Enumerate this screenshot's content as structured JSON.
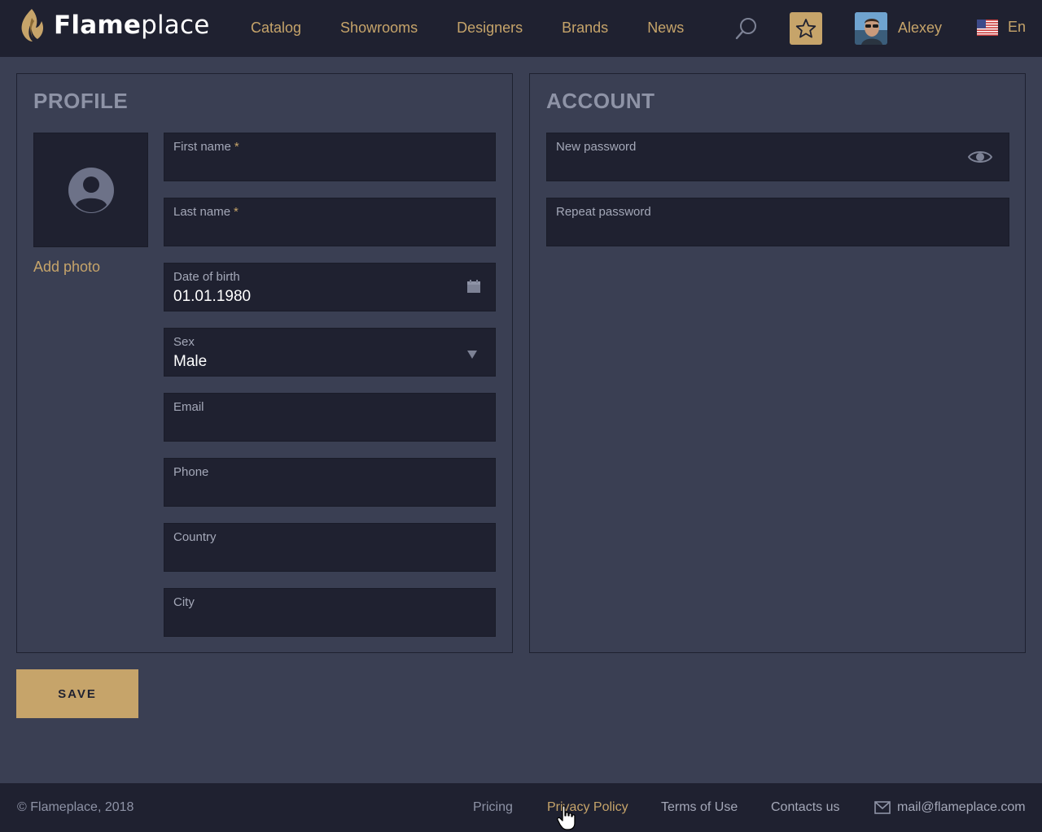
{
  "header": {
    "logo_bold": "Flame",
    "logo_light": "place",
    "nav": [
      "Catalog",
      "Showrooms",
      "Designers",
      "Brands",
      "News"
    ],
    "user_name": "Alexey",
    "language": "En",
    "icons": {
      "search": "search-icon",
      "favorites": "star-icon",
      "flag": "us-flag-icon"
    }
  },
  "profile": {
    "title": "PROFILE",
    "add_photo": "Add photo",
    "fields": {
      "first_name": {
        "label": "First name",
        "required_mark": "*",
        "value": ""
      },
      "last_name": {
        "label": "Last name",
        "required_mark": "*",
        "value": ""
      },
      "dob": {
        "label": "Date of birth",
        "value": "01.01.1980"
      },
      "sex": {
        "label": "Sex",
        "value": "Male"
      },
      "email": {
        "label": "Email",
        "value": ""
      },
      "phone": {
        "label": "Phone",
        "value": ""
      },
      "country": {
        "label": "Country",
        "value": ""
      },
      "city": {
        "label": "City",
        "value": ""
      }
    }
  },
  "account": {
    "title": "ACCOUNT",
    "fields": {
      "new_password": {
        "label": "New password",
        "value": ""
      },
      "repeat_password": {
        "label": "Repeat password",
        "value": ""
      }
    }
  },
  "save_label": "SAVE",
  "footer": {
    "copyright": "© Flameplace, 2018",
    "links": {
      "pricing": "Pricing",
      "privacy": "Privacy Policy",
      "terms": "Terms of Use",
      "contacts": "Contacts us"
    },
    "email": "mail@flameplace.com"
  },
  "colors": {
    "accent": "#c6a46a",
    "background": "#3a3f53",
    "dark": "#1f2130"
  }
}
